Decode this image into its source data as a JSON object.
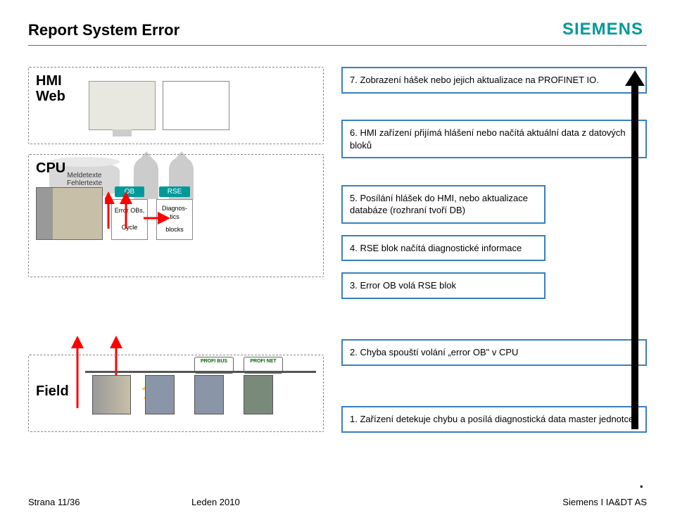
{
  "logo": "SIEMENS",
  "title": "Report System Error",
  "hmi": {
    "label_line1": "HMI",
    "label_line2": "Web"
  },
  "db": {
    "line1": "Meldetexte",
    "line2": "Fehlertexte"
  },
  "cpu": {
    "label": "CPU",
    "ob_tag": "OB",
    "ob_box_line1": "Error OBs,",
    "ob_box_line2": "Cycle",
    "rse_tag": "RSE",
    "rse_box_line1": "Diagnos-tics",
    "rse_box_line2": "blocks"
  },
  "profibus_labels": {
    "p1": "PROFI BUS",
    "p2": "PROFI NET"
  },
  "field": {
    "label": "Field"
  },
  "steps": {
    "s7": "7. Zobrazení hášek nebo jejich aktualizace na PROFINET IO.",
    "s6": "6. HMI zařízení přijímá hlášení nebo načítá aktuální data z datových bloků",
    "s5": "5. Posílání hlášek do HMI, nebo aktualizace databáze (rozhraní tvoří DB)",
    "s4": "4. RSE blok načítá diagnostické informace",
    "s3": "3. Error OB volá RSE blok",
    "s2": "2. Chyba spouští volání „error OB\" v CPU",
    "s1": "1. Zařízení detekuje chybu a posílá diagnostická data master jednotce."
  },
  "footer": {
    "left": "Strana 11/36",
    "center": "Leden 2010",
    "right": "Siemens I IA&DT AS"
  }
}
